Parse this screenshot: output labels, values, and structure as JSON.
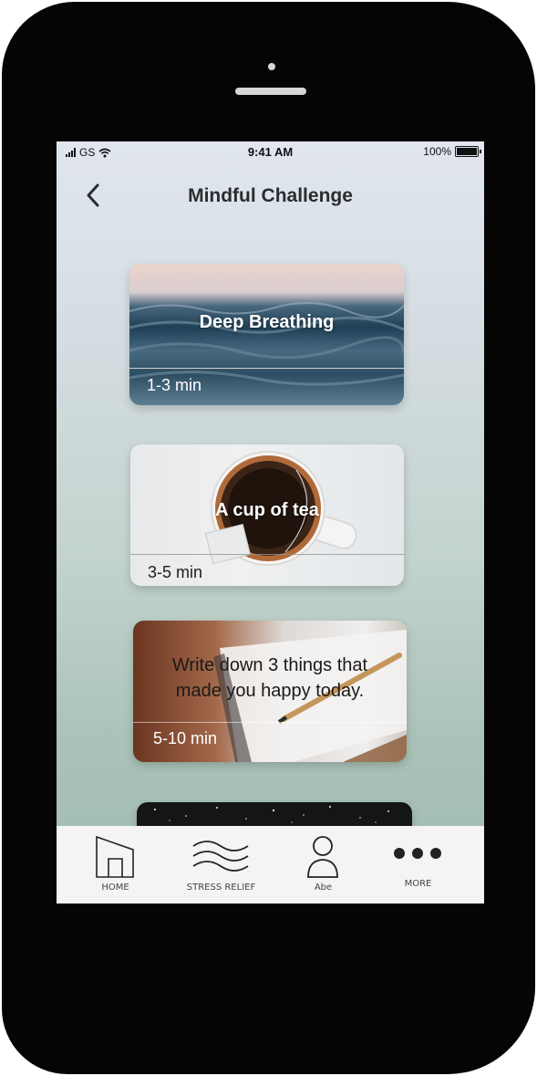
{
  "status_bar": {
    "carrier": "GS",
    "time": "9:41 AM",
    "battery": "100%"
  },
  "header": {
    "title": "Mindful Challenge",
    "back_icon": "chevron-left-icon"
  },
  "challenges": [
    {
      "title": "Deep Breathing",
      "duration": "1-3 min"
    },
    {
      "title": "A cup of tea",
      "duration": "3-5 min"
    },
    {
      "title": "Write down 3 things that made you happy today.",
      "duration": "5-10 min"
    }
  ],
  "tab_bar": [
    {
      "label": "HOME",
      "icon": "home-icon"
    },
    {
      "label": "STRESS RELIEF",
      "icon": "waves-icon"
    },
    {
      "label": "Abe",
      "icon": "person-icon"
    },
    {
      "label": "MORE",
      "icon": "more-icon"
    }
  ],
  "colors": {
    "phone_frame": "#050505",
    "tab_bar": "#f4f4f5",
    "title_text": "#2a2d30"
  }
}
